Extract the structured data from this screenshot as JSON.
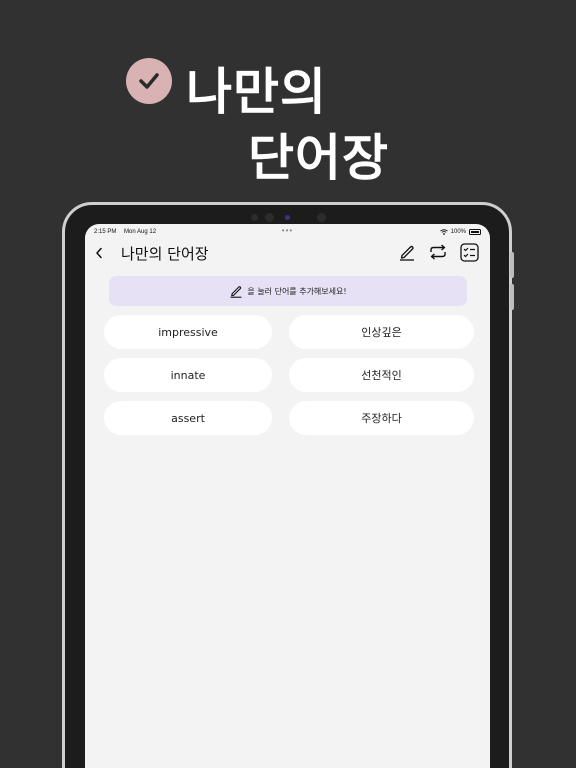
{
  "promo": {
    "heading_line1": "나만의",
    "heading_line2": "단어장",
    "check_color": "#d9b3b3",
    "check_icon": "check-icon"
  },
  "status_bar": {
    "time": "2:15 PM",
    "date": "Mon Aug 12",
    "battery": "100%"
  },
  "nav": {
    "title": "나만의 단어장",
    "icons": [
      "pencil-icon",
      "repeat-icon",
      "checklist-icon"
    ]
  },
  "hint": {
    "text": "을 눌러 단어를 추가해보세요!",
    "icon": "pencil-icon",
    "background": "#e6e1f5"
  },
  "words": [
    {
      "english": "impressive",
      "korean": "인상깊은"
    },
    {
      "english": "innate",
      "korean": "선천적인"
    },
    {
      "english": "assert",
      "korean": "주장하다"
    }
  ]
}
